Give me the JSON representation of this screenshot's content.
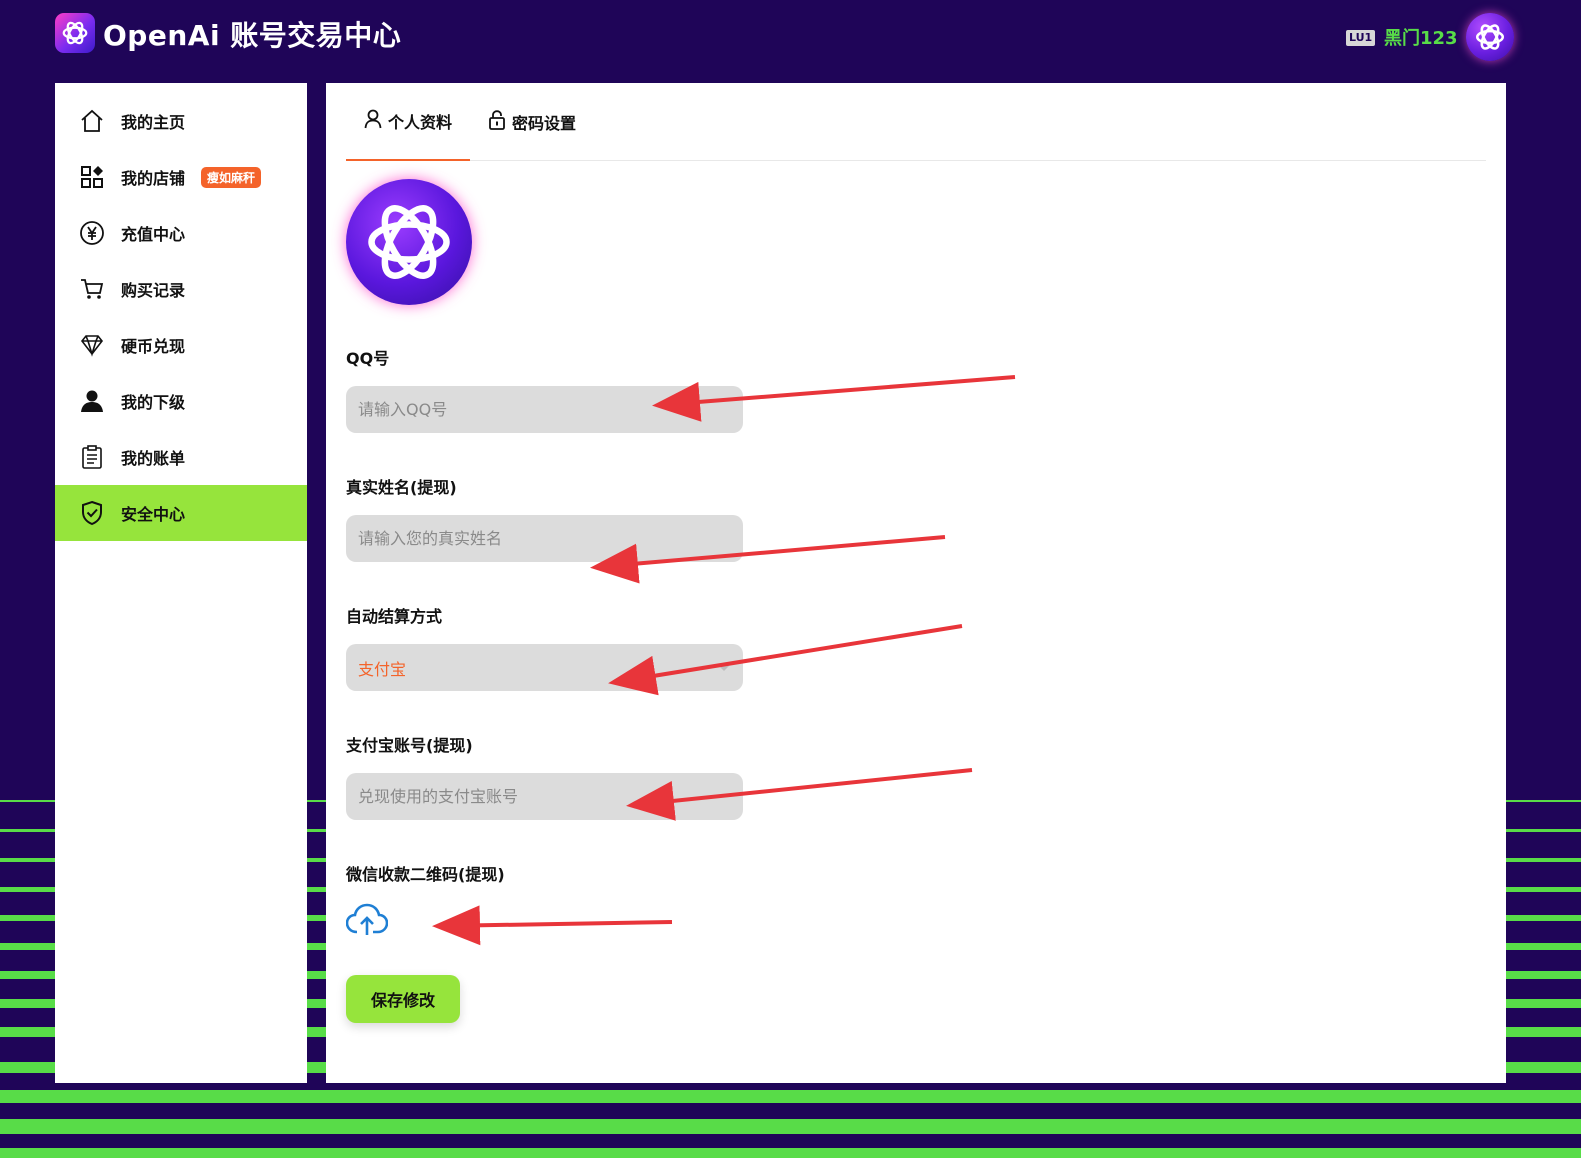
{
  "header": {
    "title": "OpenAi 账号交易中心",
    "level": "LU1",
    "username": "黑门123"
  },
  "sidebar": {
    "items": [
      {
        "label": "我的主页",
        "icon": "home-icon"
      },
      {
        "label": "我的店铺",
        "icon": "shop-grid-icon",
        "badge": "瘦如麻秆"
      },
      {
        "label": "充值中心",
        "icon": "yen-coin-icon"
      },
      {
        "label": "购买记录",
        "icon": "cart-icon"
      },
      {
        "label": "硬币兑现",
        "icon": "diamond-icon"
      },
      {
        "label": "我的下级",
        "icon": "user-icon"
      },
      {
        "label": "我的账单",
        "icon": "clipboard-icon"
      },
      {
        "label": "安全中心",
        "icon": "shield-check-icon",
        "active": true
      }
    ]
  },
  "tabs": [
    {
      "label": "个人资料",
      "icon": "user-outline-icon",
      "active": true
    },
    {
      "label": "密码设置",
      "icon": "lock-icon",
      "active": false
    }
  ],
  "form": {
    "qq": {
      "label": "QQ号",
      "placeholder": "请输入QQ号",
      "value": ""
    },
    "real_name": {
      "label": "真实姓名(提现)",
      "placeholder": "请输入您的真实姓名",
      "value": ""
    },
    "settlement": {
      "label": "自动结算方式",
      "value": "支付宝"
    },
    "alipay": {
      "label": "支付宝账号(提现)",
      "placeholder": "兑现使用的支付宝账号",
      "value": ""
    },
    "wechat_qr": {
      "label": "微信收款二维码(提现)",
      "icon": "cloud-upload-icon"
    },
    "save_label": "保存修改"
  },
  "colors": {
    "background": "#1f0558",
    "accent_green": "#96e43c",
    "accent_orange": "#f4632a",
    "stripe_green": "#58dc48",
    "annotation_arrow": "#e8353a"
  }
}
